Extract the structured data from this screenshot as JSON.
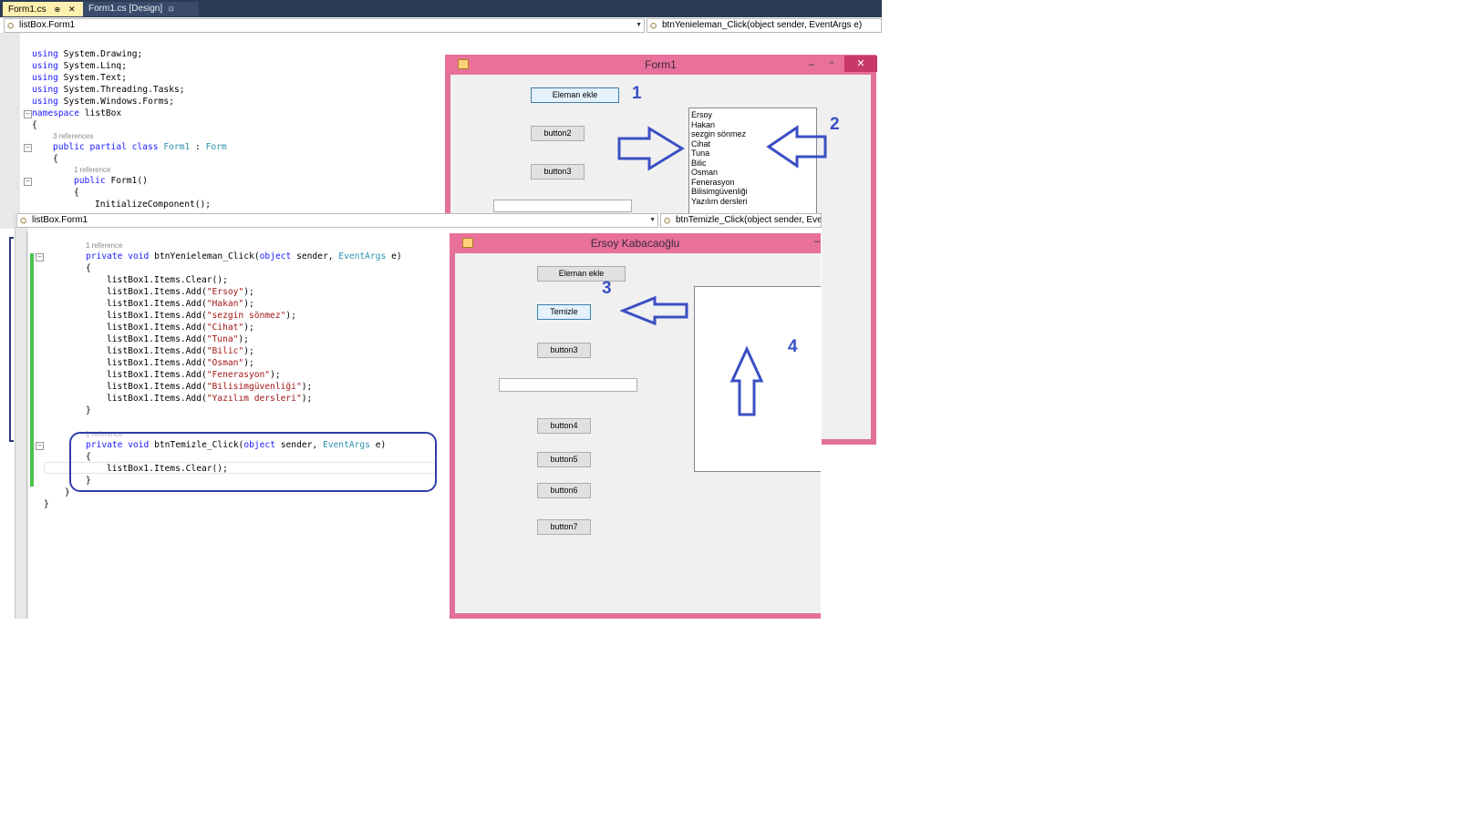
{
  "tabs": [
    {
      "label": "Form1.cs",
      "pin": "⊕",
      "close": "✕"
    },
    {
      "label": "Form1.cs [Design]",
      "lock": "🔒"
    }
  ],
  "editor1": {
    "class_combo": "listBox.Form1",
    "member_combo": "btnYenieleman_Click(object sender, EventArgs e)",
    "lines": [
      "using System.Drawing;",
      "using System.Linq;",
      "using System.Text;",
      "using System.Threading.Tasks;",
      "using System.Windows.Forms;"
    ],
    "namespace_kw": "namespace",
    "namespace_name": "listBox",
    "brace_open": "{",
    "refs_class": "3 references",
    "class_public": "public",
    "class_partial": "partial",
    "class_kw": "class",
    "class_name": "Form1",
    "class_colon": ":",
    "class_base": "Form",
    "class_brace": "{",
    "refs_ctor": "1 reference",
    "ctor_public": "public",
    "ctor_name": "Form1()",
    "ctor_brace": "{",
    "ctor_body": "InitializeComponent();"
  },
  "editor2": {
    "class_combo": "listBox.Form1",
    "member_combo": "btnTemizle_Click(object sender, Even",
    "refs1": "1 reference",
    "method1_private": "private",
    "method1_void": "void",
    "method1_name": "btnYenieleman_Click(",
    "method1_object": "object",
    "method1_sender": "sender,",
    "method1_eventargs": "EventArgs",
    "method1_e": "e)",
    "brace_open": "{",
    "clear_line": "listBox1.Items.Clear();",
    "add_prefix": "listBox1.Items.Add(",
    "add_suffix": ");",
    "add_items": [
      "\"Ersoy\"",
      "\"Hakan\"",
      "\"sezgin sönmez\"",
      "\"Cihat\"",
      "\"Tuna\"",
      "\"Bilic\"",
      "\"Osman\"",
      "\"Fenerasyon\"",
      "\"Bilisimgüvenliği\"",
      "\"Yazılım dersleri\""
    ],
    "brace_close": "}",
    "refs2": "1 reference",
    "method2_private": "private",
    "method2_void": "void",
    "method2_name": "btnTemizle_Click(",
    "method2_object": "object",
    "method2_sender": "sender,",
    "method2_eventargs": "EventArgs",
    "method2_e": "e)",
    "m2_brace_open": "{",
    "m2_body": "listBox1.Items.Clear();",
    "m2_brace_close": "}",
    "class_close": "}",
    "ns_close": "}"
  },
  "form1": {
    "title": "Form1",
    "minimize": "–",
    "maximize": "▫",
    "close": "✕",
    "buttons": [
      "Eleman ekle",
      "button2",
      "button3"
    ],
    "listbox_items": [
      "Ersoy",
      "Hakan",
      "sezgin sönmez",
      "Cihat",
      "Tuna",
      "Bilic",
      "Osman",
      "Fenerasyon",
      "Bilisimgüvenliği",
      "Yazılım dersleri"
    ],
    "label_1": "1",
    "label_2": "2"
  },
  "form2": {
    "title": "Ersoy Kabacaoğlu",
    "minimize": "–",
    "buttons": [
      "Eleman ekle",
      "Temizle",
      "button3",
      "button4",
      "button5",
      "button6",
      "button7"
    ],
    "label_3": "3",
    "label_4": "4"
  },
  "colors": {
    "annotation": "#3b4fc4",
    "form_border": "#e0709a",
    "tab_active": "#fff0b0"
  }
}
